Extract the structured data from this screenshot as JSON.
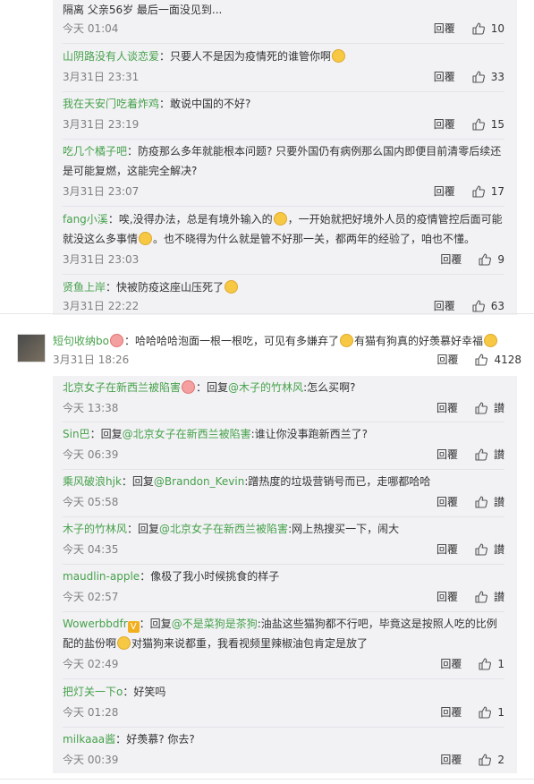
{
  "top_group": [
    {
      "prefix": "",
      "text": "隔离 父亲56岁 最后一面没见到...",
      "time": "今天 01:04",
      "reply": "回覆",
      "likes": "10"
    },
    {
      "user": "山阴路没有人谈恋爱",
      "text": "只要人不是因为疫情死的谁管你啊",
      "emoji": "yellow",
      "time": "3月31日 23:31",
      "reply": "回覆",
      "likes": "33"
    },
    {
      "user": "我在天安门吃着炸鸡",
      "text": "敢说中国的不好?",
      "time": "3月31日 23:19",
      "reply": "回覆",
      "likes": "15"
    },
    {
      "user": "吃几个橘子吧",
      "text": "防疫那么多年就能根本问题? 只要外国仍有病例那么国内即便目前清零后续还是可能复燃，这能完全解决?",
      "time": "3月31日 23:07",
      "reply": "回覆",
      "likes": "17"
    },
    {
      "user": "fang小溪",
      "text1": "唉,没得办法，总是有境外输入的",
      "text2": "，一开始就把好境外人员的疫情管控后面可能就没这么多事情",
      "text3": "。也不晓得为什么就是管不好那一关，都两年的经验了，咱也不懂。",
      "time": "3月31日 23:03",
      "reply": "回覆",
      "likes": "9"
    },
    {
      "user": "贤鱼上岸",
      "text": "快被防疫这座山压死了",
      "time": "3月31日 22:22",
      "reply": "回覆",
      "likes": "63"
    }
  ],
  "main_comment": {
    "user": "短句收纳bo",
    "text1": "哈哈哈哈泡面一根一根吃，可见有多嫌弃了",
    "text2": "有猫有狗真的好羡慕好幸福",
    "time": "3月31日 18:26",
    "reply": "回覆",
    "likes": "4128"
  },
  "sub_replies": [
    {
      "user": "北京女子在新西兰被陷害",
      "pre": "回复",
      "mention": "@木子的竹林风",
      "text": ":怎么买啊?",
      "time": "今天 13:38",
      "reply": "回覆",
      "likes": "讃"
    },
    {
      "user": "Sin巴",
      "pre": "回复",
      "mention": "@北京女子在新西兰被陷害",
      "text": ":谁让你没事跑新西兰了?",
      "time": "今天 06:39",
      "reply": "回覆",
      "likes": "讃"
    },
    {
      "user": "乘风破浪hjk",
      "pre": "回复",
      "mention": "@Brandon_Kevin",
      "text": ":蹭热度的垃圾营销号而已，走哪都哈哈",
      "time": "今天 05:58",
      "reply": "回覆",
      "likes": "讃"
    },
    {
      "user": "木子的竹林风",
      "pre": "回复",
      "mention": "@北京女子在新西兰被陷害",
      "text": ":网上热搜买一下，闹大",
      "time": "今天 04:35",
      "reply": "回覆",
      "likes": "讃"
    },
    {
      "user": "maudlin-apple",
      "text": "像极了我小时候挑食的样子",
      "time": "今天 02:57",
      "reply": "回覆",
      "likes": "讃"
    },
    {
      "user": "Wowerbbdfr",
      "pre": "回复",
      "mention": "@不是菜狗是茶狗",
      "text1": ":油盐这些猫狗都不行吧，毕竟这是按照人吃的比例配的盐份啊",
      "text2": "对猫狗来说都重，我看视频里辣椒油包肯定是放了",
      "time": "今天 02:49",
      "reply": "回覆",
      "likes": "1"
    },
    {
      "user": "把灯关一下o",
      "text": "好笑吗",
      "time": "今天 01:28",
      "reply": "回覆",
      "likes": "1"
    },
    {
      "user": "milkaaa酱",
      "text": "好羡慕? 你去?",
      "time": "今天 00:39",
      "reply": "回覆",
      "likes": "2"
    }
  ]
}
